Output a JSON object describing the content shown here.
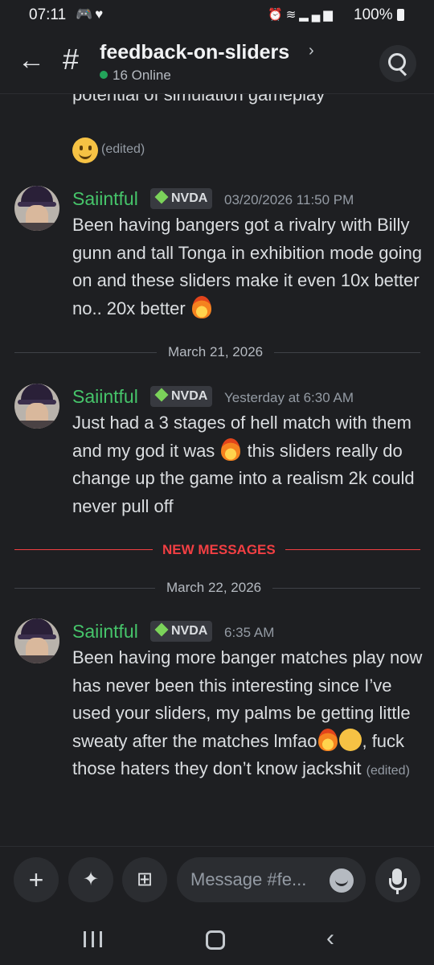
{
  "status_bar": {
    "time": "07:11",
    "left_icons": [
      "discord-icon",
      "heart-icon"
    ],
    "right_icons": [
      "alarm-icon",
      "wifi-icon",
      "volte-icon",
      "signal-icon"
    ],
    "battery": "100%"
  },
  "header": {
    "back_icon": "arrow-left-icon",
    "channel_symbol": "#",
    "channel_name": "feedback-on-sliders",
    "chevron": "›",
    "online_text": "16 Online",
    "search_icon": "search-icon"
  },
  "messages_area": {
    "cut_off_text": "potential of simulation gameplay",
    "reaction_edited": "(edited)"
  },
  "messages": [
    {
      "username": "Saiintful",
      "badge": "NVDA",
      "timestamp": "03/20/2026 11:50 PM",
      "text": "Been having bangers got a rivalry with Billy gunn and tall Tonga in exhibition mode going on  and these sliders make it even 10x better no.. 20x better"
    },
    {
      "username": "Saiintful",
      "badge": "NVDA",
      "timestamp": "Yesterday at 6:30 AM",
      "text_part1": "Just had a 3 stages of hell match with them and my god it was",
      "text_part2": "this sliders really do change up the game into a realism 2k could never pull off"
    },
    {
      "username": "Saiintful",
      "badge": "NVDA",
      "timestamp": "6:35 AM",
      "text_part1": "Been having more banger matches play now has never been this interesting since I’ve used your sliders, my palms be getting little sweaty after the matches lmfao",
      "text_part2": ",  fuck those haters they don’t know jackshit",
      "edited": "(edited)"
    }
  ],
  "dividers": {
    "date1": "March 21, 2026",
    "new_messages": "NEW MESSAGES",
    "date2": "March 22, 2026"
  },
  "composer": {
    "placeholder": "Message #fe...",
    "buttons": [
      "plus-icon",
      "apps-icon",
      "gift-icon",
      "emoji-icon",
      "mic-icon"
    ]
  },
  "colors": {
    "background": "#1e1f22",
    "username": "#46c46a",
    "new_messages": "#f23f43",
    "online": "#23a55a"
  }
}
